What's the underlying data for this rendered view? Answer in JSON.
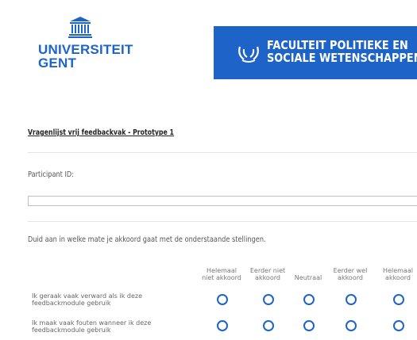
{
  "header": {
    "university_name_line1": "UNIVERSITEIT",
    "university_name_line2": "GENT",
    "faculty_line1": "FACULTEIT POLITIEKE EN",
    "faculty_line2": "SOCIALE WETENSCHAPPEN",
    "brand_color": "#1e64c8"
  },
  "form": {
    "title": "Vragenlijst vrij feedbackvak - Prototype 1",
    "participant_label": "Participant ID:",
    "participant_value": "",
    "scale_instruction": "Duid aan in welke mate je akkoord gaat met de onderstaande stellingen.",
    "scale_options": [
      "Helemaal niet akkoord",
      "Eerder niet akkoord",
      "Neutraal",
      "Eerder wel akkoord",
      "Helemaal akkoord"
    ],
    "statements": [
      "Ik geraak vaak verward als ik deze feedbackmodule gebruik",
      "Ik maak vaak fouten wanneer ik deze feedbackmodule gebruik"
    ]
  }
}
